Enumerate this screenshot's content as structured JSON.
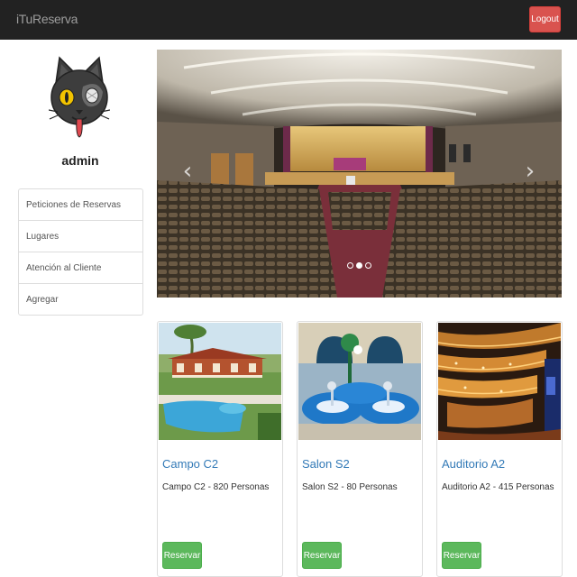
{
  "navbar": {
    "brand": "iTuReserva",
    "logout_label": "Logout"
  },
  "sidebar": {
    "username": "admin",
    "items": [
      {
        "label": "Peticiones de Reservas"
      },
      {
        "label": "Lugares"
      },
      {
        "label": "Atención al Cliente"
      },
      {
        "label": "Agregar"
      }
    ]
  },
  "carousel": {
    "prev_icon": "chevron-left-icon",
    "next_icon": "chevron-right-icon",
    "prev_glyph": "‹",
    "next_glyph": "›",
    "slide_count": 3,
    "active_index": 1
  },
  "cards": [
    {
      "title": "Campo C2",
      "desc": "Campo C2 - 820 Personas",
      "button": "Reservar"
    },
    {
      "title": "Salon S2",
      "desc": "Salon S2 - 80 Personas",
      "button": "Reservar"
    },
    {
      "title": "Auditorio A2",
      "desc": "Auditorio A2 - 415 Personas",
      "button": "Reservar"
    }
  ],
  "colors": {
    "navbar": "#222222",
    "logout": "#d9534f",
    "reservar": "#5cb85c",
    "link": "#337ab7"
  }
}
